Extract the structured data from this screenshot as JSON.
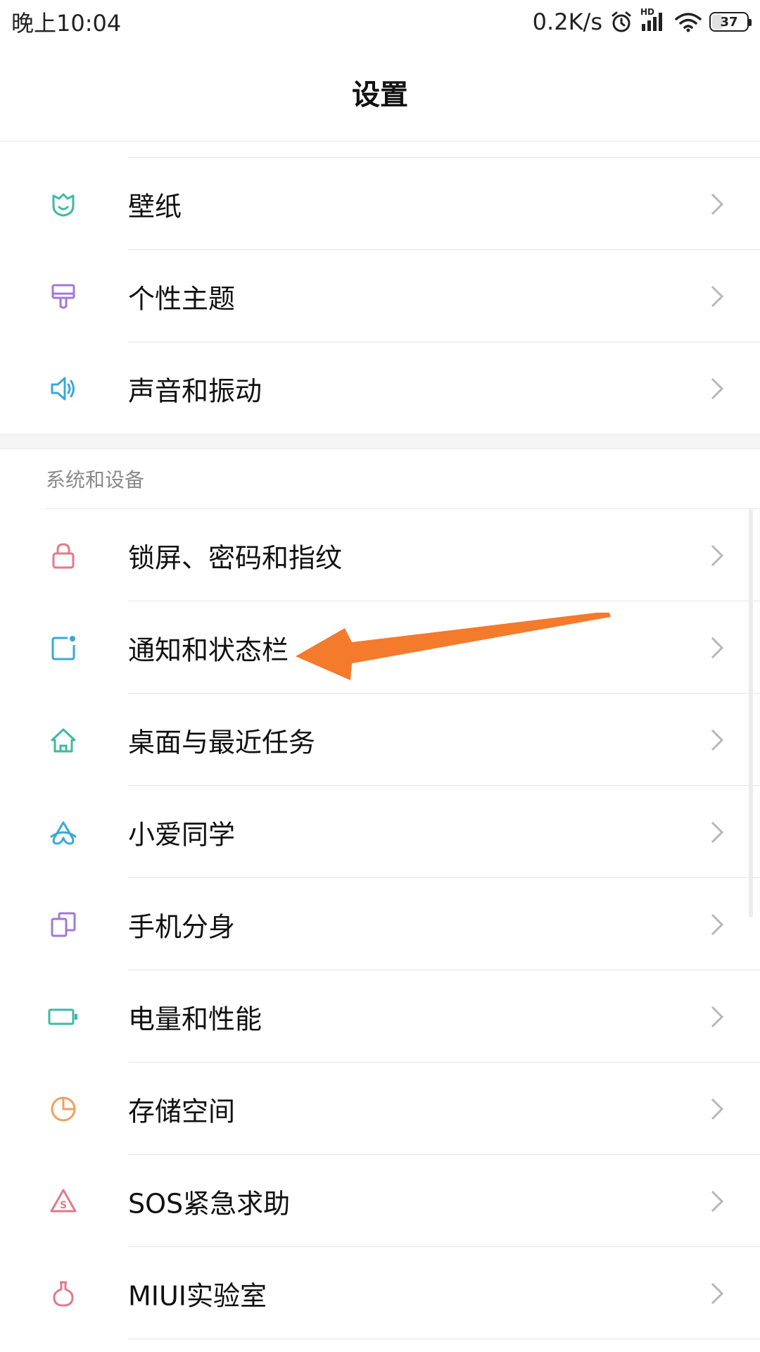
{
  "status_bar": {
    "time": "晚上10:04",
    "network_speed": "0.2K/s",
    "signal_label": "HD",
    "battery_percent": 37,
    "battery_text": "37"
  },
  "header": {
    "title": "设置"
  },
  "group_personal": {
    "items": [
      {
        "label": "壁纸",
        "icon": "wallpaper-icon",
        "color": "#3fb9a4"
      },
      {
        "label": "个性主题",
        "icon": "theme-brush-icon",
        "color": "#a07ad6"
      },
      {
        "label": "声音和振动",
        "icon": "speaker-icon",
        "color": "#3aa8d8"
      }
    ]
  },
  "group_system": {
    "title": "系统和设备",
    "items": [
      {
        "label": "锁屏、密码和指纹",
        "icon": "lock-icon",
        "color": "#e07a8a"
      },
      {
        "label": "通知和状态栏",
        "icon": "notification-icon",
        "color": "#3aa8d8"
      },
      {
        "label": "桌面与最近任务",
        "icon": "home-icon",
        "color": "#3fb9a4"
      },
      {
        "label": "小爱同学",
        "icon": "xiaoai-icon",
        "color": "#3aa8d8"
      },
      {
        "label": "手机分身",
        "icon": "dual-phone-icon",
        "color": "#a07ad6"
      },
      {
        "label": "电量和性能",
        "icon": "battery-icon",
        "color": "#3fb9a4"
      },
      {
        "label": "存储空间",
        "icon": "storage-pie-icon",
        "color": "#f0a060"
      },
      {
        "label": "SOS紧急求助",
        "icon": "sos-icon",
        "color": "#e07a8a"
      },
      {
        "label": "MIUI实验室",
        "icon": "lab-flask-icon",
        "color": "#e07a8a"
      }
    ]
  },
  "colors": {
    "annotation_arrow": "#f47a2c",
    "chevron": "#b8b8b8"
  }
}
